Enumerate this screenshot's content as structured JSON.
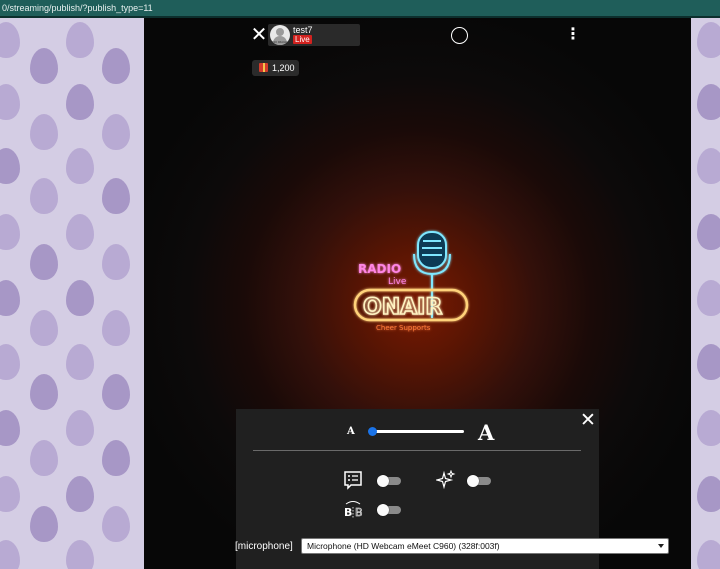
{
  "browser": {
    "url_text": "0/streaming/publish/?publish_type=11"
  },
  "header": {
    "username": "test7",
    "live_label": "Live",
    "avatar_caption": "NO IMAGE"
  },
  "gift": {
    "count": "1,200"
  },
  "logo": {
    "line1": "RADIO",
    "line2": "Live",
    "main": "ONAIR",
    "tagline": "Cheer Supports"
  },
  "panel": {
    "font_small_label": "A",
    "font_large_label": "A",
    "font_size_level": 0.0,
    "comments_toggle": false,
    "effects_toggle": false,
    "bold_toggle": false
  },
  "microphone": {
    "label": "[microphone]",
    "selected": "Microphone (HD Webcam eMeet C960) (328f:003f)"
  },
  "colors": {
    "live_badge": "#d2221f",
    "slider_accent": "#1a73e8",
    "pattern_bg": "#d4cde4"
  }
}
